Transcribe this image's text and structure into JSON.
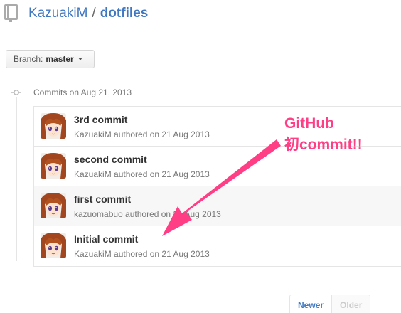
{
  "repo": {
    "owner": "KazuakiM",
    "separator": "/",
    "name": "dotfiles"
  },
  "branch": {
    "label": "Branch:",
    "value": "master"
  },
  "commit_group": {
    "label": "Commits on Aug 21, 2013"
  },
  "commits": [
    {
      "title": "3rd commit",
      "author": "KazuakiM",
      "meta_suffix": " authored on 21 Aug 2013"
    },
    {
      "title": "second commit",
      "author": "KazuakiM",
      "meta_suffix": " authored on 21 Aug 2013"
    },
    {
      "title": "first commit",
      "author": "kazuomabuo",
      "meta_suffix": " authored on 21 Aug 2013"
    },
    {
      "title": "Initial commit",
      "author": "KazuakiM",
      "meta_suffix": " authored on 21 Aug 2013"
    }
  ],
  "annotation": {
    "line1": "GitHub",
    "line2": "初commit!!",
    "color": "#ff3e86"
  },
  "pagination": {
    "newer": "Newer",
    "older": "Older"
  },
  "colors": {
    "link": "#4078c0",
    "muted": "#777777"
  }
}
